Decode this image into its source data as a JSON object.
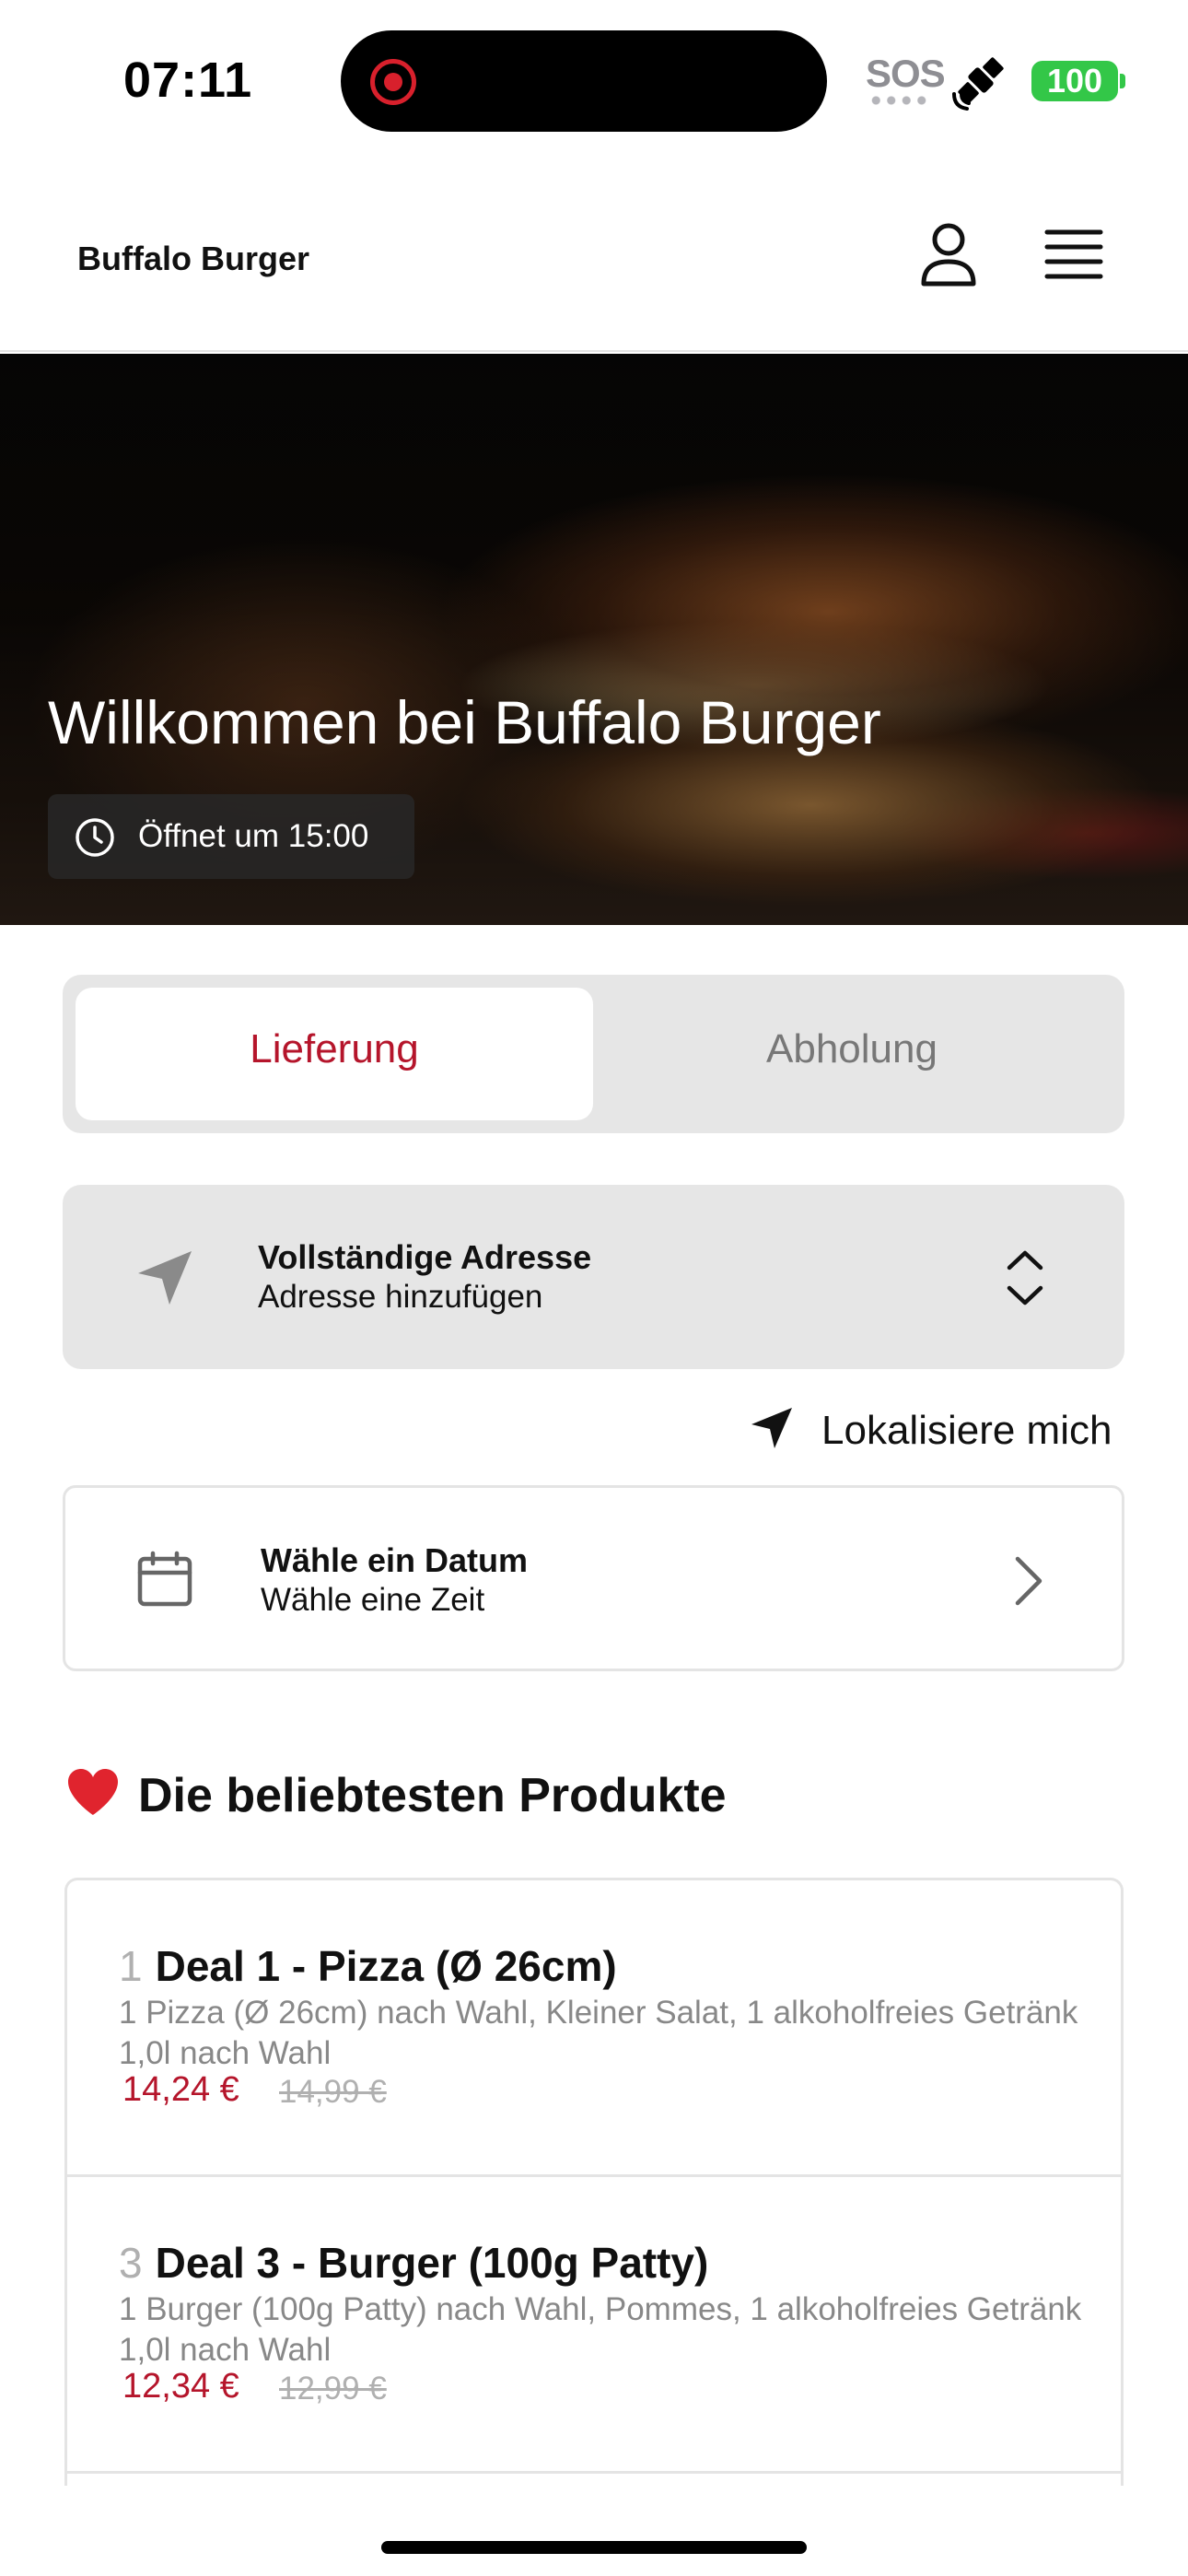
{
  "status_bar": {
    "time": "07:11",
    "sos": "SOS",
    "battery": "100",
    "icons": [
      "recording-indicator-icon",
      "satellite-icon",
      "battery-icon"
    ]
  },
  "header": {
    "brand": "Buffalo Burger",
    "icons": [
      "user-icon",
      "menu-icon"
    ]
  },
  "hero": {
    "title": "Willkommen bei Buffalo Burger",
    "opening": "Öffnet um 15:00",
    "icon": "clock-icon"
  },
  "order_mode": {
    "options": [
      {
        "label": "Lieferung",
        "selected": true
      },
      {
        "label": "Abholung",
        "selected": false
      }
    ],
    "accent_color": "#b5152b"
  },
  "address": {
    "title": "Vollständige Adresse",
    "subtitle": "Adresse hinzufügen",
    "icon": "navigation-arrow-icon"
  },
  "locate": {
    "label": "Lokalisiere mich",
    "icon": "location-arrow-icon"
  },
  "schedule": {
    "title": "Wähle ein Datum",
    "subtitle": "Wähle eine Zeit",
    "icon": "calendar-icon"
  },
  "popular": {
    "title": "Die beliebtesten Produkte",
    "icon": "heart-icon",
    "products": [
      {
        "number": "1",
        "name": "Deal 1 - Pizza (Ø 26cm)",
        "description": "1 Pizza (Ø 26cm) nach Wahl, Kleiner Salat, 1 alkoholfreies Getränk 1,0l nach Wahl",
        "price": "14,24 €",
        "old_price": "14,99 €"
      },
      {
        "number": "3",
        "name": "Deal 3 - Burger (100g Patty)",
        "description": "1 Burger (100g Patty) nach Wahl, Pommes, 1 alkoholfreies Getränk 1,0l nach Wahl",
        "price": "12,34 €",
        "old_price": "12,99 €"
      }
    ]
  }
}
